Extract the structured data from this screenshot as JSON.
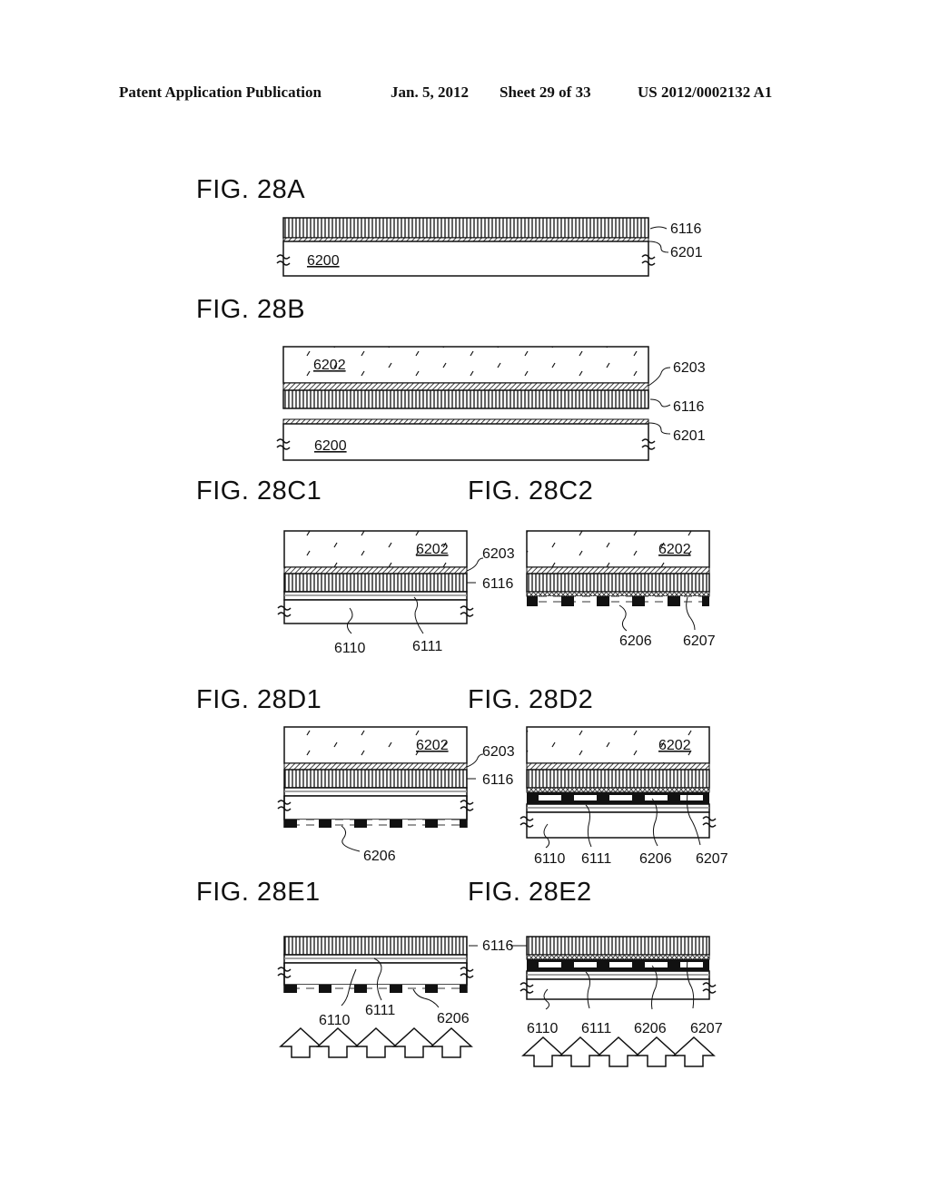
{
  "header": {
    "publication": "Patent Application Publication",
    "date": "Jan. 5, 2012",
    "sheet": "Sheet 29 of 33",
    "number": "US 2012/0002132 A1"
  },
  "figures": {
    "A": {
      "label": "FIG. 28A",
      "refs": {
        "r6116": "6116",
        "r6201": "6201",
        "r6200": "6200"
      }
    },
    "B": {
      "label": "FIG. 28B",
      "refs": {
        "r6202": "6202",
        "r6203": "6203",
        "r6116": "6116",
        "r6201": "6201",
        "r6200": "6200"
      }
    },
    "C1": {
      "label": "FIG. 28C1",
      "refs": {
        "r6202": "6202",
        "r6203": "6203",
        "r6116": "6116",
        "r6110": "6110",
        "r6111": "6111"
      }
    },
    "C2": {
      "label": "FIG. 28C2",
      "refs": {
        "r6202": "6202",
        "r6206": "6206",
        "r6207": "6207"
      }
    },
    "D1": {
      "label": "FIG. 28D1",
      "refs": {
        "r6202": "6202",
        "r6203": "6203",
        "r6116": "6116",
        "r6206": "6206"
      }
    },
    "D2": {
      "label": "FIG. 28D2",
      "refs": {
        "r6202": "6202",
        "r6110": "6110",
        "r6111": "6111",
        "r6206": "6206",
        "r6207": "6207"
      }
    },
    "E1": {
      "label": "FIG. 28E1",
      "refs": {
        "r6116": "6116",
        "r6110": "6110",
        "r6111": "6111",
        "r6206": "6206"
      }
    },
    "E2": {
      "label": "FIG. 28E2",
      "refs": {
        "r6110": "6110",
        "r6111": "6111",
        "r6206": "6206",
        "r6207": "6207"
      }
    }
  },
  "arrows": {
    "E1_count": 5,
    "E2_count": 5,
    "direction": "up"
  }
}
